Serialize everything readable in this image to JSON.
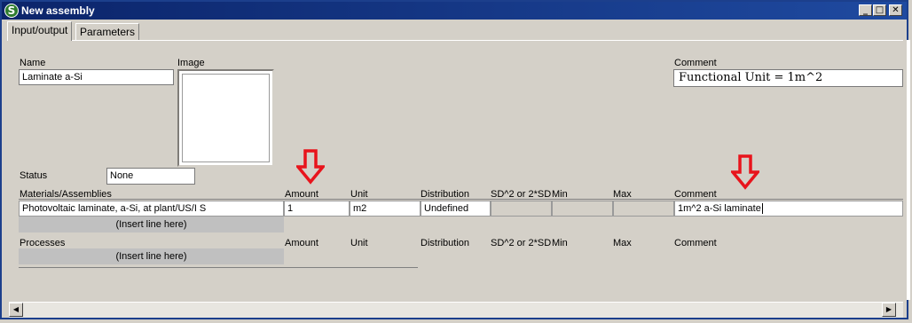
{
  "window": {
    "title": "New assembly",
    "app_icon_letter": "S",
    "controls": {
      "minimize": "_",
      "maximize": "□",
      "close": "✕"
    }
  },
  "tabs": [
    {
      "label": "Input/output",
      "active": true
    },
    {
      "label": "Parameters",
      "active": false
    }
  ],
  "form": {
    "name_label": "Name",
    "name_value": "Laminate a-Si",
    "image_label": "Image",
    "comment_label": "Comment",
    "comment_value": "Functional Unit = 1m^2",
    "status_label": "Status",
    "status_value": "None"
  },
  "materials": {
    "headers": {
      "name": "Materials/Assemblies",
      "amount": "Amount",
      "unit": "Unit",
      "distribution": "Distribution",
      "sd": "SD^2 or 2*SD",
      "min": "Min",
      "max": "Max",
      "comment": "Comment"
    },
    "rows": [
      {
        "name": "Photovoltaic laminate, a-Si, at plant/US/I S",
        "amount": "1",
        "unit": "m2",
        "distribution": "Undefined",
        "sd": "",
        "min": "",
        "max": "",
        "comment": "1m^2 a-Si laminate"
      }
    ],
    "insert_line": "(Insert line here)"
  },
  "processes": {
    "headers": {
      "name": "Processes",
      "amount": "Amount",
      "unit": "Unit",
      "distribution": "Distribution",
      "sd": "SD^2 or 2*SD",
      "min": "Min",
      "max": "Max",
      "comment": "Comment"
    },
    "insert_line": "(Insert line here)"
  },
  "colors": {
    "title_bar": "#0b246a",
    "annotation_arrow": "#e8141c"
  },
  "scrollbar": {
    "left_arrow": "◀",
    "right_arrow": "▶"
  }
}
